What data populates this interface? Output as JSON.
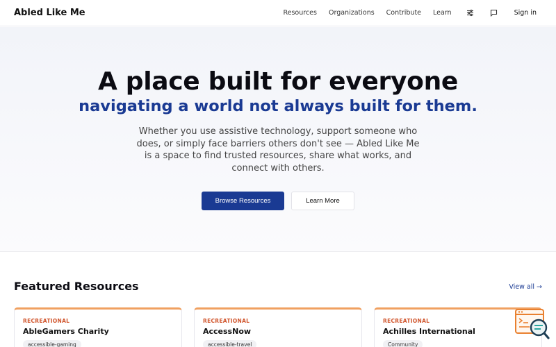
{
  "brand": "Abled Like Me",
  "nav": {
    "links": [
      "Resources",
      "Organizations",
      "Contribute",
      "Learn"
    ],
    "icons": [
      "settings-sliders-icon",
      "feedback-icon"
    ],
    "signin": "Sign in"
  },
  "hero": {
    "title": "A place built for everyone",
    "subtitle": "navigating a world not always built for them.",
    "description": "Whether you use assistive technology, support someone who does, or simply face barriers others don't see — Abled Like Me is a space to find trusted resources, share what works, and connect with others.",
    "primary_button": "Browse Resources",
    "secondary_button": "Learn More"
  },
  "featured": {
    "title": "Featured Resources",
    "view_all": "View all →",
    "cards": [
      {
        "category": "RECREATIONAL",
        "name": "AbleGamers Charity",
        "tag": "accessible-gaming"
      },
      {
        "category": "RECREATIONAL",
        "name": "AccessNow",
        "tag": "accessible-travel"
      },
      {
        "category": "RECREATIONAL",
        "name": "Achilles International",
        "tag": "Community"
      }
    ]
  },
  "helper_icon": "code-search-icon",
  "colors": {
    "accent": "#1a3a93",
    "category": "#d0542b",
    "card_top_border": "#f0a060",
    "hero_bg": "#f2f4f9"
  }
}
